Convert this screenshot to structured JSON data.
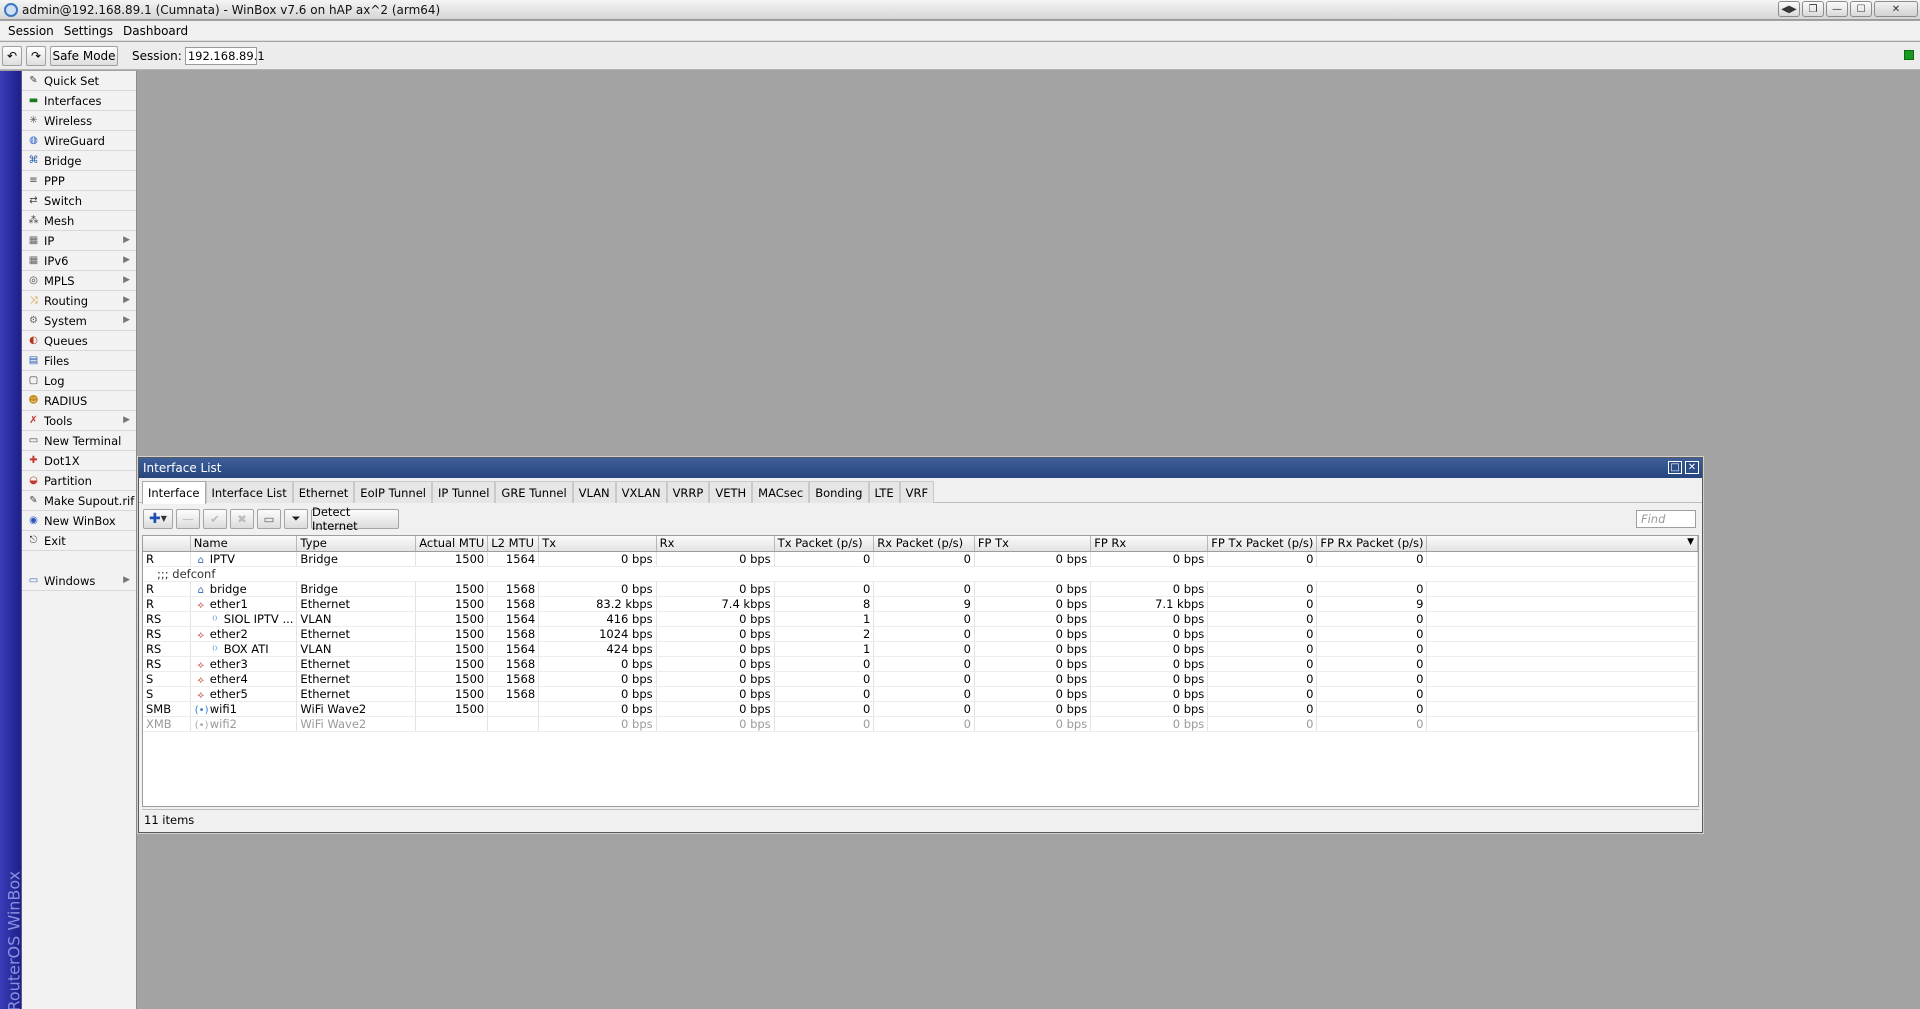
{
  "window": {
    "title": "admin@192.168.89.1 (Cumnata) - WinBox v7.6 on hAP ax^2 (arm64)"
  },
  "menubar": [
    "Session",
    "Settings",
    "Dashboard"
  ],
  "toolbar": {
    "safe_mode": "Safe Mode",
    "session_label": "Session:",
    "session_value": "192.168.89.1"
  },
  "brand": "RouterOS WinBox",
  "sidemenu": [
    {
      "label": "Quick Set",
      "icon": "wand-icon"
    },
    {
      "label": "Interfaces",
      "icon": "interfaces-icon"
    },
    {
      "label": "Wireless",
      "icon": "wireless-icon"
    },
    {
      "label": "WireGuard",
      "icon": "wireguard-icon"
    },
    {
      "label": "Bridge",
      "icon": "bridge-icon"
    },
    {
      "label": "PPP",
      "icon": "ppp-icon"
    },
    {
      "label": "Switch",
      "icon": "switch-icon"
    },
    {
      "label": "Mesh",
      "icon": "mesh-icon"
    },
    {
      "label": "IP",
      "icon": "ip-icon",
      "submenu": true
    },
    {
      "label": "IPv6",
      "icon": "ipv6-icon",
      "submenu": true
    },
    {
      "label": "MPLS",
      "icon": "mpls-icon",
      "submenu": true
    },
    {
      "label": "Routing",
      "icon": "routing-icon",
      "submenu": true
    },
    {
      "label": "System",
      "icon": "system-icon",
      "submenu": true
    },
    {
      "label": "Queues",
      "icon": "queues-icon"
    },
    {
      "label": "Files",
      "icon": "files-icon"
    },
    {
      "label": "Log",
      "icon": "log-icon"
    },
    {
      "label": "RADIUS",
      "icon": "radius-icon"
    },
    {
      "label": "Tools",
      "icon": "tools-icon",
      "submenu": true
    },
    {
      "label": "New Terminal",
      "icon": "terminal-icon"
    },
    {
      "label": "Dot1X",
      "icon": "dot1x-icon"
    },
    {
      "label": "Partition",
      "icon": "partition-icon"
    },
    {
      "label": "Make Supout.rif",
      "icon": "supout-icon"
    },
    {
      "label": "New WinBox",
      "icon": "winbox-icon"
    },
    {
      "label": "Exit",
      "icon": "exit-icon"
    },
    {
      "label": "",
      "icon": ""
    },
    {
      "label": "Windows",
      "icon": "windows-icon",
      "submenu": true
    }
  ],
  "interface_window": {
    "title": "Interface List",
    "tabs": [
      "Interface",
      "Interface List",
      "Ethernet",
      "EoIP Tunnel",
      "IP Tunnel",
      "GRE Tunnel",
      "VLAN",
      "VXLAN",
      "VRRP",
      "VETH",
      "MACsec",
      "Bonding",
      "LTE",
      "VRF"
    ],
    "active_tab": "Interface",
    "detect_internet": "Detect Internet",
    "find_placeholder": "Find",
    "columns": [
      "",
      "Name",
      "Type",
      "Actual MTU",
      "L2 MTU",
      "Tx",
      "Rx",
      "Tx Packet (p/s)",
      "Rx Packet (p/s)",
      "FP Tx",
      "FP Rx",
      "FP Tx Packet (p/s)",
      "FP Rx Packet (p/s)"
    ],
    "rows": [
      {
        "flags": "R",
        "name": "IPTV",
        "icon": "bridge-icon",
        "indent": 0,
        "type": "Bridge",
        "mtu": "1500",
        "l2mtu": "1564",
        "tx": "0 bps",
        "rx": "0 bps",
        "txp": "0",
        "rxp": "0",
        "fptx": "0 bps",
        "fprx": "0 bps",
        "fptxp": "0",
        "fprxp": "0"
      },
      {
        "comment": ";;; defconf"
      },
      {
        "flags": "R",
        "name": "bridge",
        "icon": "bridge-icon",
        "indent": 0,
        "type": "Bridge",
        "mtu": "1500",
        "l2mtu": "1568",
        "tx": "0 bps",
        "rx": "0 bps",
        "txp": "0",
        "rxp": "0",
        "fptx": "0 bps",
        "fprx": "0 bps",
        "fptxp": "0",
        "fprxp": "0"
      },
      {
        "flags": "R",
        "name": "ether1",
        "icon": "ethernet-icon",
        "indent": 0,
        "type": "Ethernet",
        "mtu": "1500",
        "l2mtu": "1568",
        "tx": "83.2 kbps",
        "rx": "7.4 kbps",
        "txp": "8",
        "rxp": "9",
        "fptx": "0 bps",
        "fprx": "7.1 kbps",
        "fptxp": "0",
        "fprxp": "9"
      },
      {
        "flags": "RS",
        "name": "SIOL IPTV ...",
        "icon": "vlan-icon",
        "indent": 1,
        "type": "VLAN",
        "mtu": "1500",
        "l2mtu": "1564",
        "tx": "416 bps",
        "rx": "0 bps",
        "txp": "1",
        "rxp": "0",
        "fptx": "0 bps",
        "fprx": "0 bps",
        "fptxp": "0",
        "fprxp": "0"
      },
      {
        "flags": "RS",
        "name": "ether2",
        "icon": "ethernet-icon",
        "indent": 0,
        "type": "Ethernet",
        "mtu": "1500",
        "l2mtu": "1568",
        "tx": "1024 bps",
        "rx": "0 bps",
        "txp": "2",
        "rxp": "0",
        "fptx": "0 bps",
        "fprx": "0 bps",
        "fptxp": "0",
        "fprxp": "0"
      },
      {
        "flags": "RS",
        "name": "BOX ATI",
        "icon": "vlan-icon",
        "indent": 1,
        "type": "VLAN",
        "mtu": "1500",
        "l2mtu": "1564",
        "tx": "424 bps",
        "rx": "0 bps",
        "txp": "1",
        "rxp": "0",
        "fptx": "0 bps",
        "fprx": "0 bps",
        "fptxp": "0",
        "fprxp": "0"
      },
      {
        "flags": "RS",
        "name": "ether3",
        "icon": "ethernet-icon",
        "indent": 0,
        "type": "Ethernet",
        "mtu": "1500",
        "l2mtu": "1568",
        "tx": "0 bps",
        "rx": "0 bps",
        "txp": "0",
        "rxp": "0",
        "fptx": "0 bps",
        "fprx": "0 bps",
        "fptxp": "0",
        "fprxp": "0"
      },
      {
        "flags": "S",
        "name": "ether4",
        "icon": "ethernet-icon",
        "indent": 0,
        "type": "Ethernet",
        "mtu": "1500",
        "l2mtu": "1568",
        "tx": "0 bps",
        "rx": "0 bps",
        "txp": "0",
        "rxp": "0",
        "fptx": "0 bps",
        "fprx": "0 bps",
        "fptxp": "0",
        "fprxp": "0"
      },
      {
        "flags": "S",
        "name": "ether5",
        "icon": "ethernet-icon",
        "indent": 0,
        "type": "Ethernet",
        "mtu": "1500",
        "l2mtu": "1568",
        "tx": "0 bps",
        "rx": "0 bps",
        "txp": "0",
        "rxp": "0",
        "fptx": "0 bps",
        "fprx": "0 bps",
        "fptxp": "0",
        "fprxp": "0"
      },
      {
        "flags": "SMB",
        "name": "wifi1",
        "icon": "wifi-icon",
        "indent": 0,
        "type": "WiFi Wave2",
        "mtu": "1500",
        "l2mtu": "",
        "tx": "0 bps",
        "rx": "0 bps",
        "txp": "0",
        "rxp": "0",
        "fptx": "0 bps",
        "fprx": "0 bps",
        "fptxp": "0",
        "fprxp": "0"
      },
      {
        "flags": "XMB",
        "name": "wifi2",
        "icon": "wifi-icon",
        "indent": 0,
        "type": "WiFi Wave2",
        "mtu": "",
        "l2mtu": "",
        "tx": "0 bps",
        "rx": "0 bps",
        "txp": "0",
        "rxp": "0",
        "fptx": "0 bps",
        "fprx": "0 bps",
        "fptxp": "0",
        "fprxp": "0",
        "disabled": true
      }
    ],
    "status": "11 items"
  },
  "colors": {
    "brand_strip": "#2a2ca0",
    "window_title": "#2f4f8a",
    "status_indicator": "#1a9a25"
  }
}
